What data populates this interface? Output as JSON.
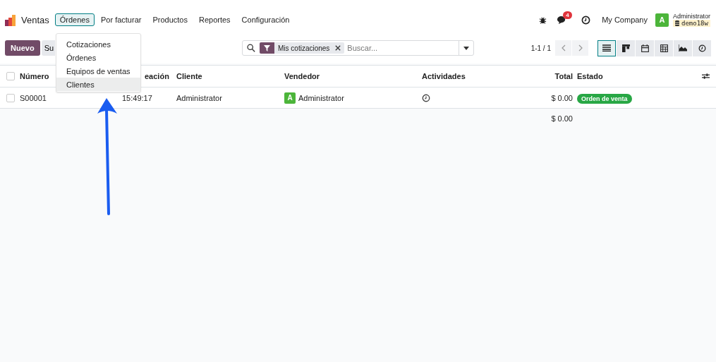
{
  "navbar": {
    "app_name": "Ventas",
    "menus": [
      {
        "label": "Órdenes",
        "selected": true
      },
      {
        "label": "Por facturar",
        "selected": false
      },
      {
        "label": "Productos",
        "selected": false
      },
      {
        "label": "Reportes",
        "selected": false
      },
      {
        "label": "Configuración",
        "selected": false
      }
    ],
    "message_count": "4",
    "company": "My Company",
    "user": {
      "initial": "A",
      "name": "Administrator",
      "database": "demo18w"
    }
  },
  "dropdown": {
    "items": [
      {
        "label": "Cotizaciones",
        "selected": false
      },
      {
        "label": "Órdenes",
        "selected": false
      },
      {
        "label": "Equipos de ventas",
        "selected": false
      },
      {
        "label": "Clientes",
        "selected": true
      }
    ]
  },
  "control_panel": {
    "new_button": "Nuevo",
    "upload_button": "Su",
    "search": {
      "facet": "Mis cotizaciones",
      "placeholder": "Buscar..."
    },
    "pager": "1-1 / 1",
    "views": [
      {
        "kind": "list",
        "selected": true
      },
      {
        "kind": "kanban",
        "selected": false
      },
      {
        "kind": "calendar",
        "selected": false
      },
      {
        "kind": "pivot",
        "selected": false
      },
      {
        "kind": "graph",
        "selected": false
      },
      {
        "kind": "activity",
        "selected": false
      }
    ]
  },
  "table": {
    "columns": [
      "Número",
      "eación",
      "Cliente",
      "Vendedor",
      "Actividades",
      "Total",
      "Estado"
    ],
    "select_all_checked": false,
    "rows": [
      {
        "checked": false,
        "number": "S00001",
        "date": "15:49:17",
        "customer": "Administrator",
        "salesperson_initial": "A",
        "salesperson": "Administrator",
        "total": "$ 0.00",
        "status": "Orden de venta"
      }
    ],
    "footer_total": "$ 0.00"
  },
  "annotation": {
    "kind": "arrow"
  }
}
